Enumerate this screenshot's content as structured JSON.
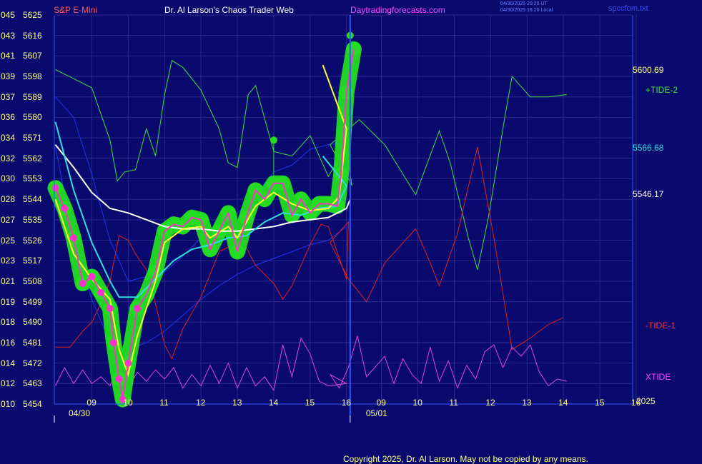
{
  "header": {
    "symbol": "S&P E-Mini",
    "title": "Dr. Al Larson's Chaos Trader Web",
    "site": "Daytradingforecasts.com",
    "ut_line": "04/30/2025 20:20 UT",
    "local_line": "04/30/2025 16:20 Local",
    "file": "spccfom.txt"
  },
  "footer": {
    "copyright": "Copyright 2025, Dr. Al Larson. May not be copied by any means."
  },
  "colors": {
    "background": "#0a0a6e",
    "grid": "#2a2a8a",
    "price": "#ff33cc",
    "price_glow": "#22dd22",
    "fast_ma": "#ffff33",
    "mid_ma": "#33dddd",
    "slow_ma": "#ffffff",
    "tide_plus2": "#44dd44",
    "tide_minus1": "#dd2222",
    "xtide": "#dd44dd",
    "band": "#2233ee"
  },
  "chart_data": {
    "type": "line",
    "ylim": [
      5454,
      5625
    ],
    "y_ticks": [
      {
        "code": "045",
        "price": 5625
      },
      {
        "code": "043",
        "price": 5616
      },
      {
        "code": "041",
        "price": 5607
      },
      {
        "code": "039",
        "price": 5598
      },
      {
        "code": "037",
        "price": 5589
      },
      {
        "code": "036",
        "price": 5580
      },
      {
        "code": "034",
        "price": 5571
      },
      {
        "code": "032",
        "price": 5562
      },
      {
        "code": "030",
        "price": 5553
      },
      {
        "code": "028",
        "price": 5544
      },
      {
        "code": "027",
        "price": 5535
      },
      {
        "code": "025",
        "price": 5526
      },
      {
        "code": "023",
        "price": 5517
      },
      {
        "code": "021",
        "price": 5508
      },
      {
        "code": "019",
        "price": 5499
      },
      {
        "code": "018",
        "price": 5490
      },
      {
        "code": "016",
        "price": 5481
      },
      {
        "code": "014",
        "price": 5472
      },
      {
        "code": "012",
        "price": 5463
      },
      {
        "code": "010",
        "price": 5454
      }
    ],
    "x_hours": [
      "09",
      "10",
      "11",
      "12",
      "13",
      "14",
      "15",
      "16",
      "09",
      "10",
      "11",
      "12",
      "13",
      "14",
      "15",
      "16"
    ],
    "dates": [
      "04/30",
      "05/01"
    ],
    "right_labels": [
      {
        "text": "5600.69",
        "price": 5600.69
      },
      {
        "text": "5566.68",
        "price": 5566.68
      },
      {
        "text": "5546.17",
        "price": 5546.17
      }
    ],
    "series_labels": [
      "+TIDE-2",
      "-TIDE-1",
      "XTIDE"
    ],
    "corner_label": "2025",
    "price": [
      [
        8.0,
        5549
      ],
      [
        8.25,
        5540
      ],
      [
        8.5,
        5527
      ],
      [
        8.75,
        5507
      ],
      [
        9.0,
        5510
      ],
      [
        9.25,
        5503
      ],
      [
        9.5,
        5496
      ],
      [
        9.6,
        5481
      ],
      [
        9.75,
        5465
      ],
      [
        9.85,
        5456
      ],
      [
        10.0,
        5472
      ],
      [
        10.25,
        5496
      ],
      [
        10.5,
        5502
      ],
      [
        10.75,
        5512
      ],
      [
        11.0,
        5530
      ],
      [
        11.25,
        5533
      ],
      [
        11.5,
        5532
      ],
      [
        11.75,
        5536
      ],
      [
        12.0,
        5535
      ],
      [
        12.25,
        5522
      ],
      [
        12.5,
        5530
      ],
      [
        12.75,
        5538
      ],
      [
        13.0,
        5521
      ],
      [
        13.25,
        5536
      ],
      [
        13.5,
        5548
      ],
      [
        13.75,
        5544
      ],
      [
        14.0,
        5551
      ],
      [
        14.25,
        5551
      ],
      [
        14.5,
        5537
      ],
      [
        14.75,
        5544
      ],
      [
        15.0,
        5538
      ],
      [
        15.25,
        5542
      ],
      [
        15.5,
        5542
      ],
      [
        15.75,
        5541
      ],
      [
        15.85,
        5555
      ],
      [
        16.0,
        5591
      ],
      [
        16.2,
        5610
      ]
    ],
    "price_peaks": [
      [
        14.0,
        5570
      ],
      [
        16.1,
        5616
      ]
    ],
    "fast_ma": [
      [
        8.0,
        5544
      ],
      [
        8.5,
        5520
      ],
      [
        9.0,
        5509
      ],
      [
        9.5,
        5500
      ],
      [
        9.75,
        5478
      ],
      [
        10.0,
        5467
      ],
      [
        10.25,
        5484
      ],
      [
        10.75,
        5508
      ],
      [
        11.0,
        5525
      ],
      [
        11.5,
        5531
      ],
      [
        12.0,
        5532
      ],
      [
        12.25,
        5527
      ],
      [
        12.75,
        5532
      ],
      [
        13.0,
        5527
      ],
      [
        13.5,
        5541
      ],
      [
        14.0,
        5547
      ],
      [
        14.5,
        5542
      ],
      [
        15.0,
        5539
      ],
      [
        15.5,
        5540
      ],
      [
        15.8,
        5545
      ],
      [
        16.0,
        5575
      ],
      [
        16.3,
        5603
      ]
    ],
    "mid_ma": [
      [
        8.0,
        5578
      ],
      [
        8.5,
        5548
      ],
      [
        9.0,
        5525
      ],
      [
        9.5,
        5508
      ],
      [
        9.75,
        5501
      ],
      [
        10.25,
        5501
      ],
      [
        10.75,
        5509
      ],
      [
        11.25,
        5517
      ],
      [
        11.75,
        5522
      ],
      [
        12.25,
        5524
      ],
      [
        12.75,
        5527
      ],
      [
        13.25,
        5528
      ],
      [
        13.75,
        5534
      ],
      [
        14.25,
        5538
      ],
      [
        14.75,
        5537
      ],
      [
        15.25,
        5540
      ],
      [
        15.75,
        5541
      ],
      [
        16.0,
        5550
      ],
      [
        16.3,
        5563
      ]
    ],
    "slow_ma": [
      [
        8.0,
        5568
      ],
      [
        8.5,
        5558
      ],
      [
        9.0,
        5547
      ],
      [
        9.5,
        5540
      ],
      [
        10.0,
        5538
      ],
      [
        10.5,
        5535
      ],
      [
        11.0,
        5532
      ],
      [
        11.5,
        5531
      ],
      [
        12.0,
        5531
      ],
      [
        12.5,
        5530
      ],
      [
        13.0,
        5530
      ],
      [
        13.5,
        5531
      ],
      [
        14.0,
        5532
      ],
      [
        14.5,
        5534
      ],
      [
        15.0,
        5535
      ],
      [
        15.5,
        5536
      ],
      [
        16.0,
        5540
      ],
      [
        16.1,
        5544
      ]
    ],
    "tide_plus2": [
      [
        8.0,
        5601
      ],
      [
        8.5,
        5597
      ],
      [
        9.0,
        5593
      ],
      [
        9.5,
        5570
      ],
      [
        9.7,
        5552
      ],
      [
        9.9,
        5556
      ],
      [
        10.2,
        5557
      ],
      [
        10.5,
        5575
      ],
      [
        10.75,
        5563
      ],
      [
        11.0,
        5590
      ],
      [
        11.2,
        5605
      ],
      [
        11.5,
        5602
      ],
      [
        12.0,
        5592
      ],
      [
        12.5,
        5575
      ],
      [
        12.75,
        5560
      ],
      [
        13.0,
        5558
      ],
      [
        13.3,
        5590
      ],
      [
        13.5,
        5594
      ],
      [
        14.0,
        5565
      ],
      [
        14.5,
        5563
      ],
      [
        15.0,
        5572
      ],
      [
        15.5,
        5554
      ],
      [
        15.8,
        5562
      ],
      [
        16.0,
        5565
      ],
      [
        16.15,
        5550
      ],
      [
        16.5,
        5568
      ],
      [
        17.3,
        5579
      ],
      [
        18.0,
        5568
      ],
      [
        18.85,
        5546
      ],
      [
        19.5,
        5574
      ],
      [
        19.8,
        5560
      ],
      [
        20.3,
        5527
      ],
      [
        20.55,
        5513
      ],
      [
        20.85,
        5536
      ],
      [
        21.3,
        5580
      ],
      [
        21.5,
        5598
      ],
      [
        22.0,
        5589
      ],
      [
        22.5,
        5589
      ],
      [
        23.0,
        5590
      ]
    ],
    "tide_minus1": [
      [
        8.0,
        5479
      ],
      [
        8.4,
        5479
      ],
      [
        8.75,
        5486
      ],
      [
        9.0,
        5490
      ],
      [
        9.3,
        5500
      ],
      [
        9.5,
        5508
      ],
      [
        9.75,
        5528
      ],
      [
        10.0,
        5526
      ],
      [
        10.2,
        5520
      ],
      [
        10.5,
        5513
      ],
      [
        10.8,
        5495
      ],
      [
        11.0,
        5480
      ],
      [
        11.2,
        5474
      ],
      [
        11.5,
        5487
      ],
      [
        12.0,
        5501
      ],
      [
        12.5,
        5521
      ],
      [
        13.0,
        5525
      ],
      [
        13.2,
        5524
      ],
      [
        13.5,
        5515
      ],
      [
        14.0,
        5507
      ],
      [
        14.25,
        5500
      ],
      [
        14.5,
        5506
      ],
      [
        15.0,
        5524
      ],
      [
        15.3,
        5533
      ],
      [
        15.5,
        5532
      ],
      [
        16.0,
        5509
      ],
      [
        16.05,
        5534
      ],
      [
        16.5,
        5525
      ],
      [
        17.0,
        5509
      ],
      [
        17.5,
        5499
      ],
      [
        18.0,
        5516
      ],
      [
        18.85,
        5531
      ],
      [
        19.25,
        5516
      ],
      [
        19.5,
        5506
      ],
      [
        20.0,
        5529
      ],
      [
        20.55,
        5567
      ],
      [
        21.0,
        5527
      ],
      [
        21.5,
        5478
      ],
      [
        22.0,
        5483
      ],
      [
        22.5,
        5489
      ],
      [
        22.9,
        5492
      ]
    ],
    "xtide": [
      [
        8.0,
        5462
      ],
      [
        8.25,
        5470
      ],
      [
        8.5,
        5463
      ],
      [
        8.75,
        5469
      ],
      [
        9.0,
        5463
      ],
      [
        9.25,
        5466
      ],
      [
        9.5,
        5462
      ],
      [
        9.75,
        5471
      ],
      [
        10.0,
        5461
      ],
      [
        10.25,
        5468
      ],
      [
        10.5,
        5464
      ],
      [
        10.75,
        5469
      ],
      [
        11.0,
        5465
      ],
      [
        11.25,
        5470
      ],
      [
        11.5,
        5461
      ],
      [
        11.75,
        5467
      ],
      [
        12.0,
        5462
      ],
      [
        12.25,
        5471
      ],
      [
        12.5,
        5463
      ],
      [
        12.75,
        5472
      ],
      [
        13.0,
        5461
      ],
      [
        13.25,
        5470
      ],
      [
        13.5,
        5462
      ],
      [
        13.75,
        5466
      ],
      [
        14.0,
        5460
      ],
      [
        14.25,
        5480
      ],
      [
        14.5,
        5466
      ],
      [
        14.75,
        5483
      ],
      [
        15.0,
        5476
      ],
      [
        15.25,
        5464
      ],
      [
        15.5,
        5462
      ],
      [
        16.0,
        5463
      ],
      [
        16.5,
        5467
      ],
      [
        16.75,
        5461
      ],
      [
        17.0,
        5470
      ],
      [
        17.25,
        5484
      ],
      [
        17.5,
        5466
      ],
      [
        18.0,
        5475
      ],
      [
        18.25,
        5463
      ],
      [
        18.5,
        5474
      ],
      [
        18.75,
        5467
      ],
      [
        19.0,
        5463
      ],
      [
        19.25,
        5479
      ],
      [
        19.5,
        5464
      ],
      [
        19.75,
        5473
      ],
      [
        20.0,
        5461
      ],
      [
        20.25,
        5471
      ],
      [
        20.5,
        5465
      ],
      [
        20.75,
        5477
      ],
      [
        21.0,
        5480
      ],
      [
        21.25,
        5470
      ],
      [
        21.5,
        5479
      ],
      [
        21.75,
        5475
      ],
      [
        22.0,
        5480
      ],
      [
        22.25,
        5468
      ],
      [
        22.5,
        5462
      ],
      [
        22.75,
        5465
      ],
      [
        23.0,
        5464
      ]
    ],
    "band_upper": [
      [
        8.0,
        5589
      ],
      [
        8.5,
        5580
      ],
      [
        9.0,
        5555
      ],
      [
        9.5,
        5526
      ],
      [
        10.0,
        5508
      ],
      [
        10.5,
        5510
      ],
      [
        11.0,
        5512
      ],
      [
        11.5,
        5519
      ],
      [
        12.0,
        5527
      ],
      [
        12.5,
        5533
      ],
      [
        13.0,
        5538
      ],
      [
        13.5,
        5546
      ],
      [
        14.0,
        5556
      ],
      [
        14.5,
        5559
      ],
      [
        15.0,
        5566
      ],
      [
        15.5,
        5568
      ],
      [
        16.0,
        5569
      ]
    ],
    "band_lower": [
      [
        8.0,
        5567
      ],
      [
        8.5,
        5526
      ],
      [
        9.0,
        5500
      ],
      [
        9.5,
        5481
      ],
      [
        10.0,
        5478
      ],
      [
        10.5,
        5481
      ],
      [
        11.0,
        5486
      ],
      [
        11.5,
        5493
      ],
      [
        12.0,
        5500
      ],
      [
        12.5,
        5506
      ],
      [
        13.0,
        5511
      ],
      [
        13.5,
        5515
      ],
      [
        14.0,
        5518
      ],
      [
        14.5,
        5521
      ],
      [
        15.0,
        5524
      ],
      [
        15.5,
        5526
      ],
      [
        16.0,
        5532
      ]
    ]
  }
}
